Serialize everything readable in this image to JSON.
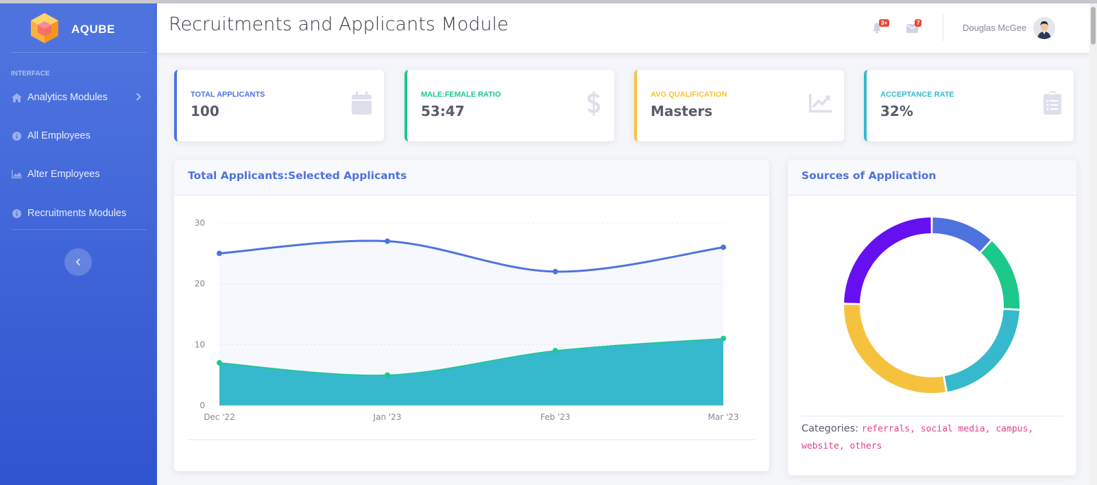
{
  "brand": {
    "name": "AQUBE"
  },
  "sidebar": {
    "heading": "INTERFACE",
    "items": [
      {
        "label": "Analytics Modules",
        "icon": "home-icon"
      },
      {
        "label": "All Employees",
        "icon": "info-icon"
      },
      {
        "label": "Alter Employees",
        "icon": "chart-area-icon"
      },
      {
        "label": "Recruitments Modules",
        "icon": "info-icon"
      }
    ]
  },
  "header": {
    "title": "Recruitments and Applicants Module",
    "alerts_badge": "3+",
    "messages_badge": "7",
    "user_name": "Douglas McGee"
  },
  "stats": [
    {
      "label": "TOTAL APPLICANTS",
      "value": "100",
      "color": "#4e73df",
      "icon": "calendar-icon"
    },
    {
      "label": "MALE:FEMALE RATIO",
      "value": "53:47",
      "color": "#1cc88a",
      "icon": "dollar-icon"
    },
    {
      "label": "AVG QUALIFICATION",
      "value": "Masters",
      "color": "#f6c23e",
      "icon": "chart-line-icon"
    },
    {
      "label": "ACCEPTANCE RATE",
      "value": "32%",
      "color": "#36b9cc",
      "icon": "clipboard-list-icon"
    }
  ],
  "panels": {
    "area_title": "Total Applicants:Selected Applicants",
    "donut_title": "Sources of Application",
    "categories_label": "Categories:",
    "categories": [
      "referrals",
      "social media",
      "campus",
      "website",
      "others"
    ]
  },
  "chart_data": [
    {
      "type": "area",
      "title": "Total Applicants:Selected Applicants",
      "categories": [
        "Dec '22",
        "Jan '23",
        "Feb '23",
        "Mar '23"
      ],
      "series": [
        {
          "values": [
            25,
            27,
            22,
            26
          ],
          "color": "#4e73df"
        },
        {
          "values": [
            7,
            5,
            9,
            11
          ],
          "color": "#36b9cc"
        }
      ],
      "ylim": [
        0,
        30
      ],
      "yticks": [
        0,
        10,
        20,
        30
      ],
      "grid": true
    },
    {
      "type": "pie",
      "title": "Sources of Application",
      "categories": [
        "referrals",
        "social media",
        "campus",
        "website",
        "others"
      ],
      "values": [
        11,
        13,
        20,
        26,
        23
      ],
      "colors": [
        "#4e73df",
        "#1cc88a",
        "#36b9cc",
        "#f6c23e",
        "#6610f2"
      ]
    }
  ]
}
